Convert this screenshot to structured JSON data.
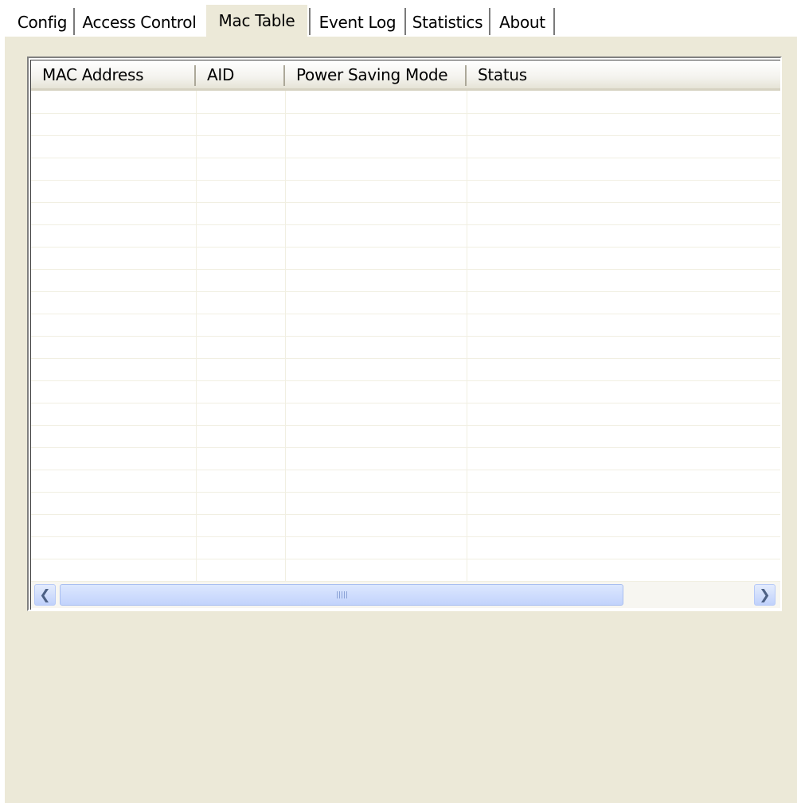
{
  "tabs": [
    {
      "label": "Config",
      "selected": false
    },
    {
      "label": "Access Control",
      "selected": false
    },
    {
      "label": "Mac Table",
      "selected": true
    },
    {
      "label": "Event Log",
      "selected": false
    },
    {
      "label": "Statistics",
      "selected": false
    },
    {
      "label": "About",
      "selected": false
    }
  ],
  "mac_table": {
    "columns": [
      "MAC Address",
      "AID",
      "Power Saving Mode",
      "Status"
    ],
    "rows": []
  },
  "scrollbar": {
    "left_icon": "scroll-left-arrow-icon",
    "right_icon": "scroll-right-arrow-icon",
    "left_glyph": "❮",
    "right_glyph": "❯"
  }
}
